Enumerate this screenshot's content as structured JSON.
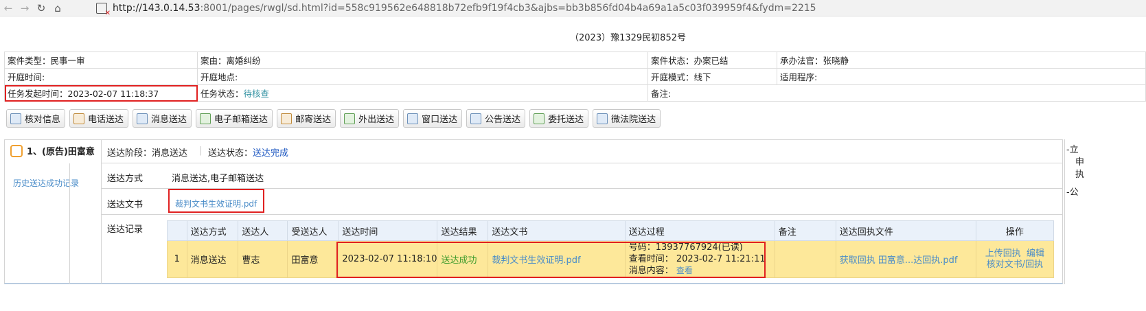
{
  "browser": {
    "url_host": "http://143.0.14.53",
    "url_rest": ":8001/pages/rwgl/sd.html?id=558c919562e648818b72efb9f19f4cb3&ajbs=bb3b856fd04b4a69a1a5c03f039959f4&fydm=2215"
  },
  "case": {
    "number": "（2023）豫1329民初852号",
    "type": "案件类型：民事一审",
    "cause": "案由：离婚纠纷",
    "state": "案件状态：办案已结",
    "judge": "承办法官：张晓静",
    "hearing_time": "开庭时间:",
    "hearing_place": "开庭地点:",
    "hearing_mode": "开庭模式：线下",
    "procedure": "适用程序:",
    "task_start": "任务发起时间：2023-02-07 11:18:37",
    "task_state_label": "任务状态：",
    "task_state_value": "待核查",
    "remark": "备注:"
  },
  "toolbar": [
    {
      "label": "核对信息",
      "icon": "verify-icon"
    },
    {
      "label": "电话送达",
      "icon": "phone-icon"
    },
    {
      "label": "消息送达",
      "icon": "message-icon"
    },
    {
      "label": "电子邮箱送达",
      "icon": "email-icon"
    },
    {
      "label": "邮寄送达",
      "icon": "mail-icon"
    },
    {
      "label": "外出送达",
      "icon": "outgoing-icon"
    },
    {
      "label": "窗口送达",
      "icon": "window-icon"
    },
    {
      "label": "公告送达",
      "icon": "announcement-icon"
    },
    {
      "label": "委托送达",
      "icon": "entrust-icon"
    },
    {
      "label": "微法院送达",
      "icon": "micro-court-icon"
    }
  ],
  "party": {
    "name": "1、(原告)田富意",
    "history_link": "历史送达成功记录",
    "stage": "送达阶段：消息送达",
    "status_label": "送达状态：",
    "status_value": "送达完成",
    "method_label": "送达方式",
    "method_value": "消息送达,电子邮箱送达",
    "docs_label": "送达文书",
    "docs_value": "裁判文书生效证明.pdf",
    "records_label": "送达记录"
  },
  "records": {
    "headers": [
      "",
      "送达方式",
      "送达人",
      "受送达人",
      "送达时间",
      "送达结果",
      "送达文书",
      "送达过程",
      "备注",
      "送达回执文件",
      "操作"
    ],
    "row": {
      "index": "1",
      "method": "消息送达",
      "sender": "曹志",
      "recipient": "田富意",
      "time": "2023-02-07 11:18:10",
      "result": "送达成功",
      "doc": "裁判文书生效证明.pdf",
      "proc_line1": "号码：13937767924(已读)",
      "proc_line2": "查看时间：  2023-02-7 11:21:11",
      "proc_line3_label": "消息内容：",
      "proc_line3_link": "查看",
      "remark": "",
      "receipt": "获取回执   田富意...达回执.pdf",
      "op_upload": "上传回执",
      "op_edit": "编辑",
      "op_verify": "核对文书/回执"
    }
  },
  "right_edge": {
    "line1": "-立",
    "line2": "申",
    "line3": "执",
    "line4": "-公"
  }
}
